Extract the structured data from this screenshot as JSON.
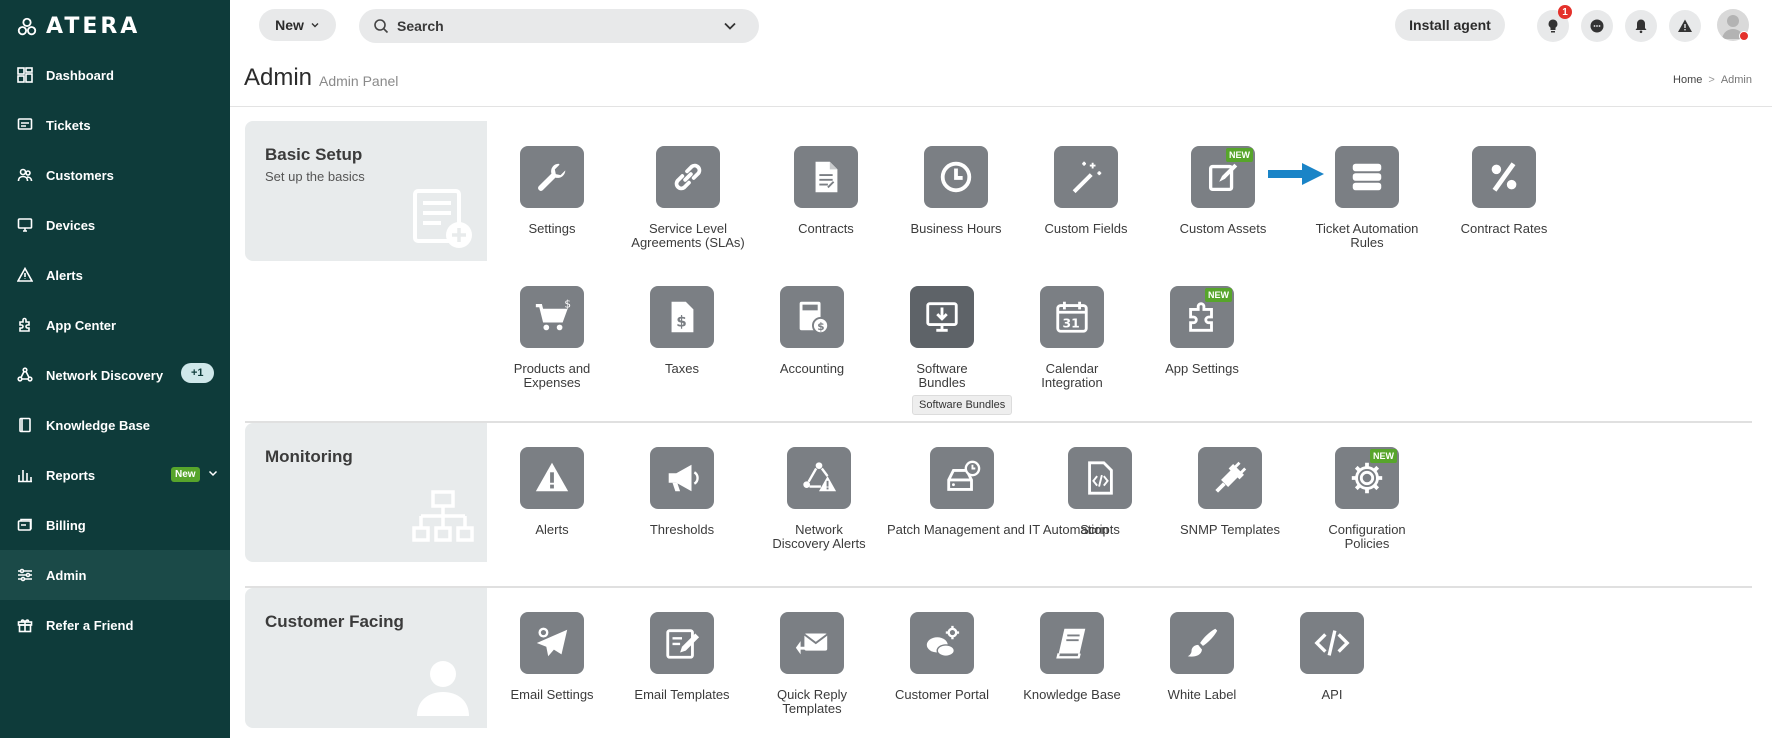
{
  "brand": {
    "name": "ATERA",
    "sidebar_bg": "#0e3b3a",
    "accent_green": "#57a52b",
    "accent_blue": "#1a84c7"
  },
  "sidebar": {
    "items": [
      {
        "label": "Dashboard",
        "icon": "dashboard-icon"
      },
      {
        "label": "Tickets",
        "icon": "ticket-icon"
      },
      {
        "label": "Customers",
        "icon": "customers-icon"
      },
      {
        "label": "Devices",
        "icon": "monitor-icon"
      },
      {
        "label": "Alerts",
        "icon": "alert-triangle-icon"
      },
      {
        "label": "App Center",
        "icon": "app-center-icon"
      },
      {
        "label": "Network Discovery",
        "icon": "network-icon",
        "badge": "+1"
      },
      {
        "label": "Knowledge Base",
        "icon": "book-icon"
      },
      {
        "label": "Reports",
        "icon": "bar-chart-icon",
        "badge": "New"
      },
      {
        "label": "Billing",
        "icon": "billing-icon"
      },
      {
        "label": "Admin",
        "icon": "sliders-icon",
        "active": true
      },
      {
        "label": "Refer a Friend",
        "icon": "gift-icon"
      }
    ]
  },
  "topbar": {
    "new_label": "New",
    "search_placeholder": "Search",
    "install_label": "Install agent",
    "notification_count": "1"
  },
  "header": {
    "title": "Admin",
    "subtitle": "Admin Panel",
    "breadcrumb": [
      "Home",
      "Admin"
    ]
  },
  "sections": {
    "basic": {
      "title": "Basic Setup",
      "subtitle": "Set up the basics",
      "tiles": [
        {
          "label": "Settings",
          "icon": "wrench-icon"
        },
        {
          "label": "Service Level Agreements (SLAs)",
          "icon": "link-icon"
        },
        {
          "label": "Contracts",
          "icon": "contract-icon"
        },
        {
          "label": "Business Hours",
          "icon": "clock-icon"
        },
        {
          "label": "Custom Fields",
          "icon": "magic-wand-icon"
        },
        {
          "label": "Custom Assets",
          "icon": "edit-icon",
          "tag": "NEW"
        },
        {
          "label": "Ticket Automation Rules",
          "icon": "server-list-icon"
        },
        {
          "label": "Contract Rates",
          "icon": "percent-icon"
        },
        {
          "label": "Products and Expenses",
          "icon": "cart-icon"
        },
        {
          "label": "Taxes",
          "icon": "tax-file-icon"
        },
        {
          "label": "Accounting",
          "icon": "calculator-icon"
        },
        {
          "label": "Software Bundles",
          "icon": "download-monitor-icon"
        },
        {
          "label": "Calendar Integration",
          "icon": "calendar-icon"
        },
        {
          "label": "App Settings",
          "icon": "puzzle-icon",
          "tag": "NEW"
        }
      ],
      "tooltip": "Software Bundles"
    },
    "monitoring": {
      "title": "Monitoring",
      "tiles": [
        {
          "label": "Alerts",
          "icon": "warning-icon"
        },
        {
          "label": "Thresholds",
          "icon": "megaphone-icon"
        },
        {
          "label": "Network Discovery Alerts",
          "icon": "network-alert-icon"
        },
        {
          "label": "Patch Management and IT Automation",
          "icon": "patch-icon"
        },
        {
          "label": "Scripts",
          "icon": "code-file-icon"
        },
        {
          "label": "SNMP Templates",
          "icon": "plug-icon"
        },
        {
          "label": "Configuration Policies",
          "icon": "cog-icon",
          "tag": "NEW"
        }
      ]
    },
    "customer": {
      "title": "Customer Facing",
      "tiles": [
        {
          "label": "Email Settings",
          "icon": "email-settings-icon"
        },
        {
          "label": "Email Templates",
          "icon": "email-template-icon"
        },
        {
          "label": "Quick Reply Templates",
          "icon": "reply-mail-icon"
        },
        {
          "label": "Customer Portal",
          "icon": "chat-gear-icon"
        },
        {
          "label": "Knowledge Base",
          "icon": "kb-book-icon"
        },
        {
          "label": "White Label",
          "icon": "brush-icon"
        },
        {
          "label": "API",
          "icon": "code-icon"
        }
      ]
    }
  }
}
